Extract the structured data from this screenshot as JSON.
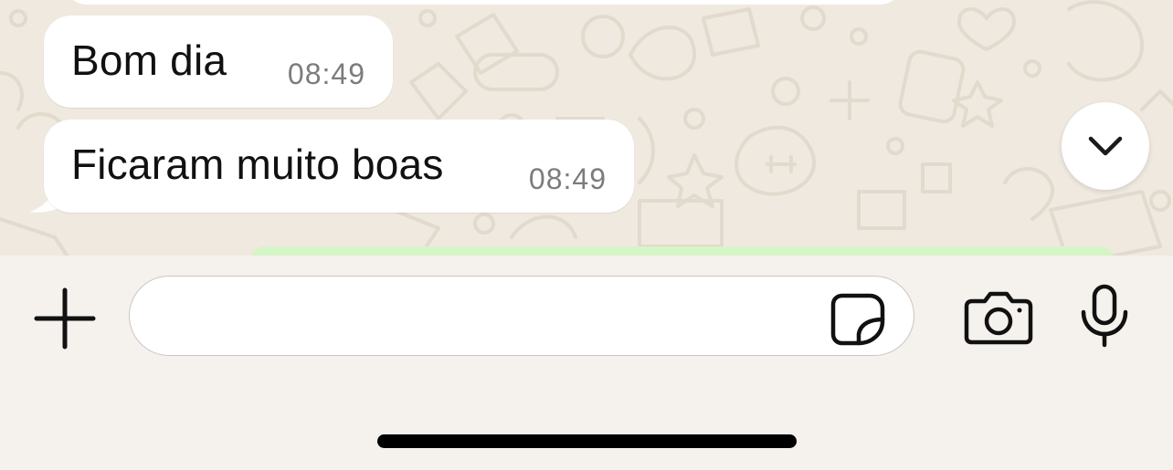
{
  "messages": [
    {
      "text": "Bom dia",
      "time": "08:49"
    },
    {
      "text": "Ficaram muito boas",
      "time": "08:49"
    }
  ],
  "composer": {
    "placeholder": "",
    "value": ""
  },
  "icons": {
    "attach": "plus-icon",
    "sticker": "sticker-icon",
    "camera": "camera-icon",
    "mic": "microphone-icon",
    "scroll": "chevron-down-icon"
  },
  "colors": {
    "incoming_bubble": "#ffffff",
    "outgoing_bubble": "#d6f5c7",
    "chat_background": "#efe9df",
    "input_bar": "#f5f2ee"
  }
}
